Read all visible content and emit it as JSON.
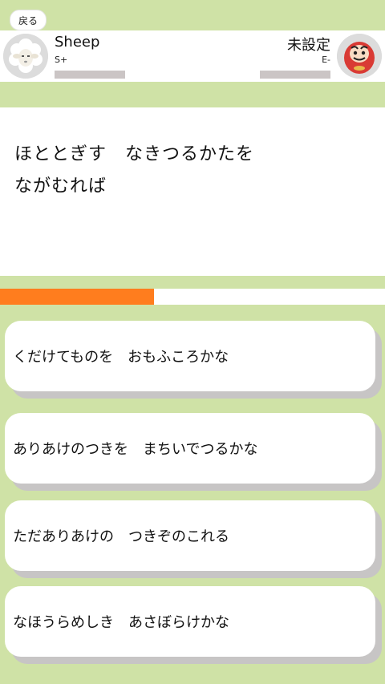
{
  "header": {
    "back_label": "戻る"
  },
  "player_left": {
    "name": "Sheep",
    "rank": "S+",
    "avatar": "sheep-icon"
  },
  "player_right": {
    "name": "未設定",
    "rank": "E-",
    "avatar": "daruma-icon"
  },
  "question": {
    "line1": "ほととぎす　なきつるかたを",
    "line2": "ながむれば"
  },
  "timer": {
    "progress": 0.4
  },
  "choices": [
    "くだけてものを　おもふころかな",
    "ありあけのつきを　まちいでつるかな",
    "ただありあけの　つきぞのこれる",
    "なほうらめしき　あさぼらけかな"
  ],
  "colors": {
    "background": "#cfe2a6",
    "timer": "#ff7d1e",
    "shadow": "#c7c5c5"
  }
}
